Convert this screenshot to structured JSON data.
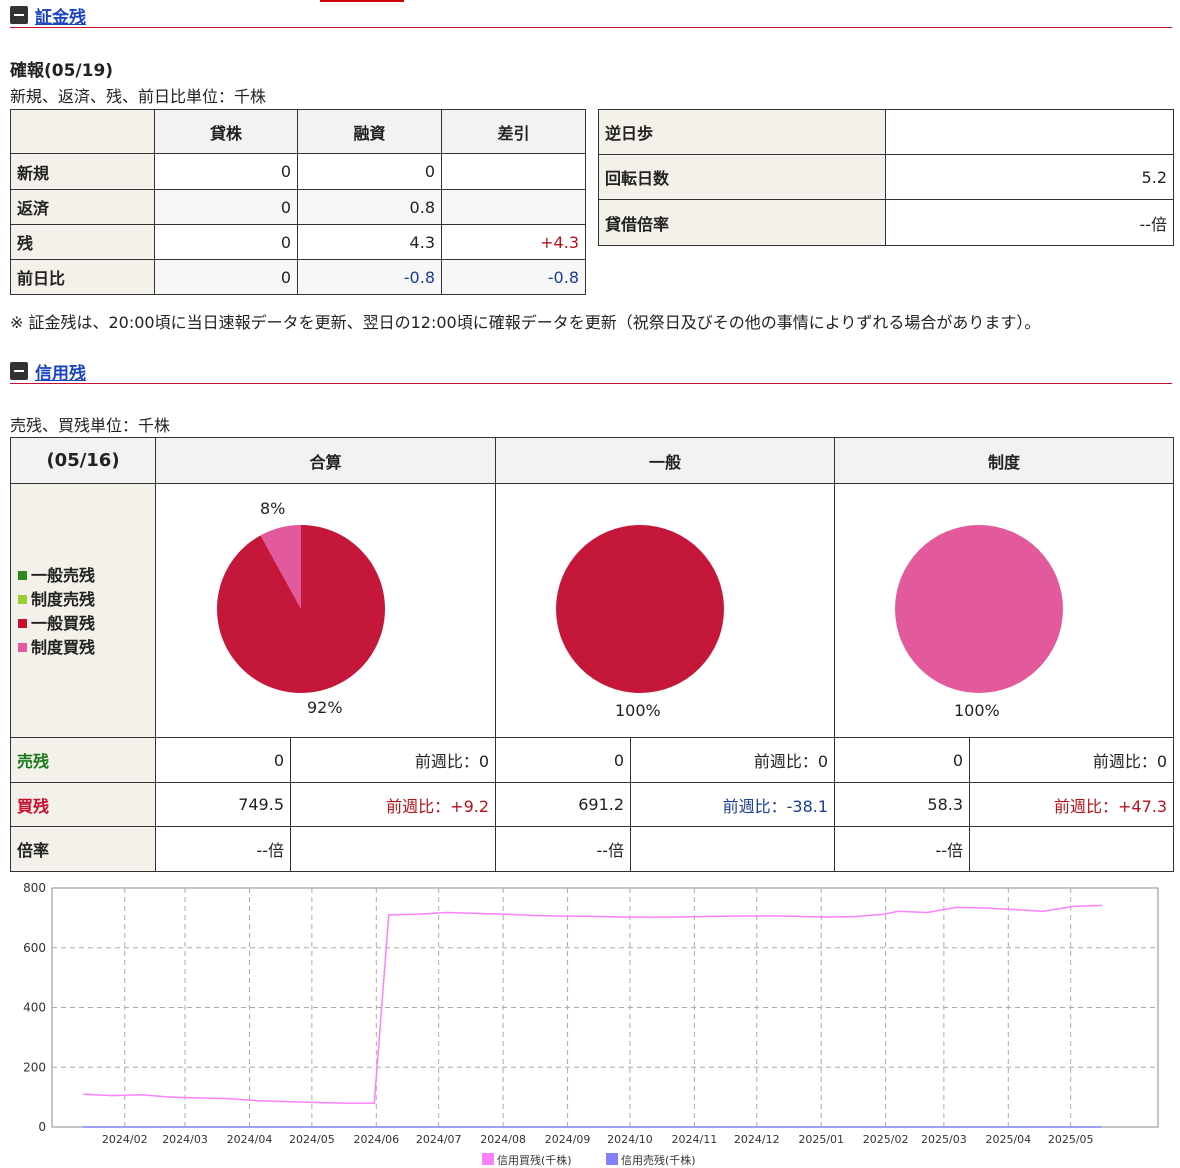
{
  "margin_section": {
    "title": "証金残",
    "confirmed_label": "確報(05/19)",
    "unit_note": "新規、返済、残、前日比単位：千株",
    "table": {
      "headers": [
        "",
        "貸株",
        "融資",
        "差引"
      ],
      "rows": [
        {
          "label": "新規",
          "lend": "0",
          "loan": "0",
          "diff": ""
        },
        {
          "label": "返済",
          "lend": "0",
          "loan": "0.8",
          "diff": ""
        },
        {
          "label": "残",
          "lend": "0",
          "loan": "4.3",
          "diff": "+4.3"
        },
        {
          "label": "前日比",
          "lend": "0",
          "loan": "-0.8",
          "diff": "-0.8"
        }
      ]
    },
    "side_table": [
      {
        "label": "逆日歩",
        "value": ""
      },
      {
        "label": "回転日数",
        "value": "5.2"
      },
      {
        "label": "貸借倍率",
        "value": "--倍"
      }
    ],
    "footnote": "※ 証金残は、20:00頃に当日速報データを更新、翌日の12:00頃に確報データを更新（祝祭日及びその他の事情によりずれる場合があります）。"
  },
  "credit_section": {
    "title": "信用残",
    "unit_note": "売残、買残単位：千株",
    "date_header": "(05/16)",
    "column_headers": [
      "合算",
      "一般",
      "制度"
    ],
    "legend": [
      {
        "label": "一般売残",
        "color": "#2f8a1e"
      },
      {
        "label": "制度売残",
        "color": "#9acd32"
      },
      {
        "label": "一般買残",
        "color": "#c8102e"
      },
      {
        "label": "制度買残",
        "color": "#e25a9c"
      }
    ],
    "pies": [
      {
        "labels": {
          "small": "8%",
          "large": "92%"
        }
      },
      {
        "labels": {
          "large": "100%"
        }
      },
      {
        "labels": {
          "large": "100%"
        }
      }
    ],
    "rows": [
      {
        "label": "売残",
        "cells": [
          {
            "value": "0",
            "change": "前週比：0"
          },
          {
            "value": "0",
            "change": "前週比：0"
          },
          {
            "value": "0",
            "change": "前週比：0"
          }
        ]
      },
      {
        "label": "買残",
        "cells": [
          {
            "value": "749.5",
            "change": "前週比：+9.2"
          },
          {
            "value": "691.2",
            "change": "前週比：-38.1"
          },
          {
            "value": "58.3",
            "change": "前週比：+47.3"
          }
        ]
      },
      {
        "label": "倍率",
        "cells": [
          {
            "value": "--倍",
            "change": ""
          },
          {
            "value": "--倍",
            "change": ""
          },
          {
            "value": "--倍",
            "change": ""
          }
        ]
      }
    ]
  },
  "chart_data": [
    {
      "type": "pie",
      "slices": [
        {
          "name": "制度買残",
          "value": 8,
          "color": "#e25a9c"
        },
        {
          "name": "一般買残",
          "value": 92,
          "color": "#c4173a"
        }
      ]
    },
    {
      "type": "pie",
      "slices": [
        {
          "name": "一般買残",
          "value": 100,
          "color": "#c4173a"
        }
      ]
    },
    {
      "type": "pie",
      "slices": [
        {
          "name": "制度買残",
          "value": 100,
          "color": "#e25a9c"
        }
      ]
    },
    {
      "type": "line",
      "title": "",
      "xlabel": "",
      "ylabel": "",
      "ylim": [
        0,
        800
      ],
      "yticks": [
        "0",
        "200",
        "400",
        "600",
        "800"
      ],
      "xticks": [
        "2024/02",
        "2024/03",
        "2024/04",
        "2024/05",
        "2024/06",
        "2024/07",
        "2024/08",
        "2024/09",
        "2024/10",
        "2024/11",
        "2024/12",
        "2025/01",
        "2025/02",
        "2025/03",
        "2025/04",
        "2025/05"
      ],
      "grid": true,
      "legend_position": "bottom",
      "series": [
        {
          "name": "信用買残(千株)",
          "color": "#ff80ff",
          "points": [
            [
              "2024/01/12",
              110
            ],
            [
              "2024/01/26",
              105
            ],
            [
              "2024/02/09",
              108
            ],
            [
              "2024/02/23",
              100
            ],
            [
              "2024/03/08",
              97
            ],
            [
              "2024/03/22",
              95
            ],
            [
              "2024/04/05",
              88
            ],
            [
              "2024/04/19",
              85
            ],
            [
              "2024/05/03",
              82
            ],
            [
              "2024/05/17",
              80
            ],
            [
              "2024/05/31",
              80
            ],
            [
              "2024/06/07",
              710
            ],
            [
              "2024/06/21",
              712
            ],
            [
              "2024/07/05",
              718
            ],
            [
              "2024/07/19",
              715
            ],
            [
              "2024/08/02",
              712
            ],
            [
              "2024/08/16",
              708
            ],
            [
              "2024/08/30",
              706
            ],
            [
              "2024/09/13",
              705
            ],
            [
              "2024/09/27",
              703
            ],
            [
              "2024/10/11",
              702
            ],
            [
              "2024/10/25",
              703
            ],
            [
              "2024/11/08",
              705
            ],
            [
              "2024/11/22",
              706
            ],
            [
              "2024/12/06",
              707
            ],
            [
              "2024/12/20",
              705
            ],
            [
              "2025/01/03",
              703
            ],
            [
              "2025/01/17",
              704
            ],
            [
              "2025/01/31",
              712
            ],
            [
              "2025/02/07",
              722
            ],
            [
              "2025/02/21",
              718
            ],
            [
              "2025/03/07",
              735
            ],
            [
              "2025/03/21",
              733
            ],
            [
              "2025/04/04",
              728
            ],
            [
              "2025/04/18",
              722
            ],
            [
              "2025/05/02",
              738
            ],
            [
              "2025/05/16",
              742
            ]
          ]
        },
        {
          "name": "信用売残(千株)",
          "color": "#8080ff",
          "points": [
            [
              "2024/01/12",
              0
            ],
            [
              "2024/06/07",
              0
            ],
            [
              "2025/01/03",
              0
            ],
            [
              "2025/05/16",
              0
            ]
          ]
        }
      ]
    }
  ]
}
